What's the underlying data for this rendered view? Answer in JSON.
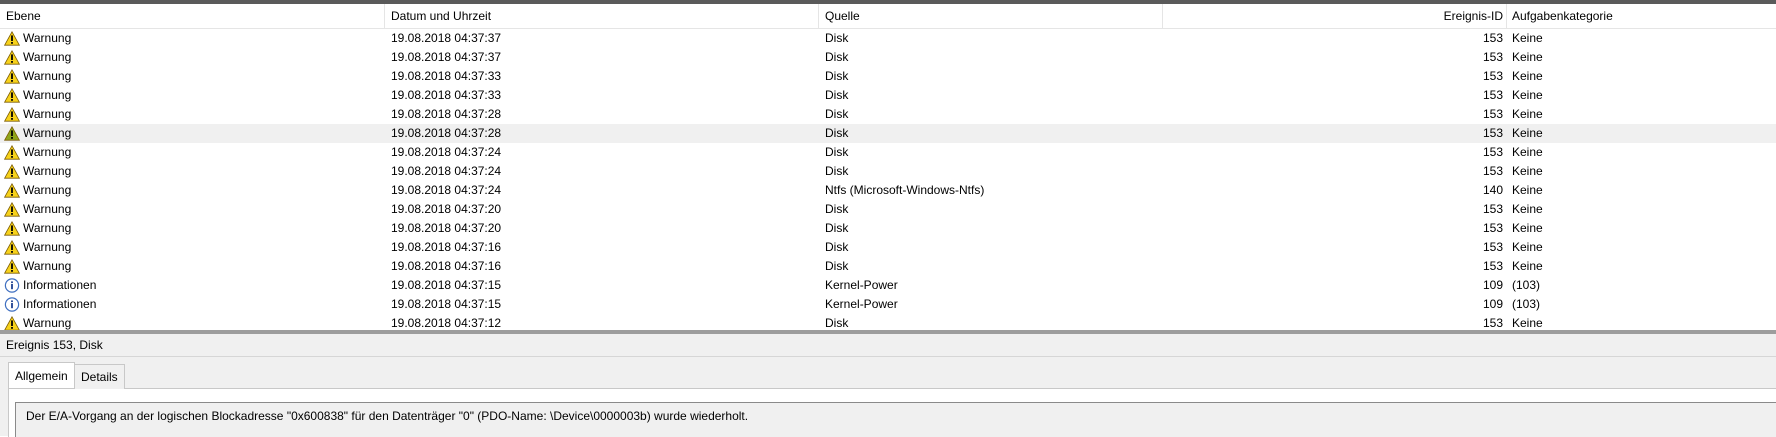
{
  "columns": {
    "level": "Ebene",
    "datetime": "Datum und Uhrzeit",
    "source": "Quelle",
    "event_id": "Ereignis-ID",
    "task_category": "Aufgabenkategorie"
  },
  "rows": [
    {
      "level": "Warnung",
      "icon": "warning-icon",
      "datetime": "19.08.2018 04:37:37",
      "source": "Disk",
      "event_id": "153",
      "category": "Keine"
    },
    {
      "level": "Warnung",
      "icon": "warning-icon",
      "datetime": "19.08.2018 04:37:37",
      "source": "Disk",
      "event_id": "153",
      "category": "Keine"
    },
    {
      "level": "Warnung",
      "icon": "warning-icon",
      "datetime": "19.08.2018 04:37:33",
      "source": "Disk",
      "event_id": "153",
      "category": "Keine"
    },
    {
      "level": "Warnung",
      "icon": "warning-icon",
      "datetime": "19.08.2018 04:37:33",
      "source": "Disk",
      "event_id": "153",
      "category": "Keine"
    },
    {
      "level": "Warnung",
      "icon": "warning-icon",
      "datetime": "19.08.2018 04:37:28",
      "source": "Disk",
      "event_id": "153",
      "category": "Keine"
    },
    {
      "level": "Warnung",
      "icon": "warning-icon",
      "datetime": "19.08.2018 04:37:28",
      "source": "Disk",
      "event_id": "153",
      "category": "Keine"
    },
    {
      "level": "Warnung",
      "icon": "warning-icon",
      "datetime": "19.08.2018 04:37:24",
      "source": "Disk",
      "event_id": "153",
      "category": "Keine"
    },
    {
      "level": "Warnung",
      "icon": "warning-icon",
      "datetime": "19.08.2018 04:37:24",
      "source": "Disk",
      "event_id": "153",
      "category": "Keine"
    },
    {
      "level": "Warnung",
      "icon": "warning-icon",
      "datetime": "19.08.2018 04:37:24",
      "source": "Ntfs (Microsoft-Windows-Ntfs)",
      "event_id": "140",
      "category": "Keine"
    },
    {
      "level": "Warnung",
      "icon": "warning-icon",
      "datetime": "19.08.2018 04:37:20",
      "source": "Disk",
      "event_id": "153",
      "category": "Keine"
    },
    {
      "level": "Warnung",
      "icon": "warning-icon",
      "datetime": "19.08.2018 04:37:20",
      "source": "Disk",
      "event_id": "153",
      "category": "Keine"
    },
    {
      "level": "Warnung",
      "icon": "warning-icon",
      "datetime": "19.08.2018 04:37:16",
      "source": "Disk",
      "event_id": "153",
      "category": "Keine"
    },
    {
      "level": "Warnung",
      "icon": "warning-icon",
      "datetime": "19.08.2018 04:37:16",
      "source": "Disk",
      "event_id": "153",
      "category": "Keine"
    },
    {
      "level": "Informationen",
      "icon": "info-icon",
      "datetime": "19.08.2018 04:37:15",
      "source": "Kernel-Power",
      "event_id": "109",
      "category": "(103)"
    },
    {
      "level": "Informationen",
      "icon": "info-icon",
      "datetime": "19.08.2018 04:37:15",
      "source": "Kernel-Power",
      "event_id": "109",
      "category": "(103)"
    },
    {
      "level": "Warnung",
      "icon": "warning-icon",
      "datetime": "19.08.2018 04:37:12",
      "source": "Disk",
      "event_id": "153",
      "category": "Keine"
    }
  ],
  "selected_row": 5,
  "detail": {
    "title": "Ereignis 153, Disk",
    "tabs": [
      "Allgemein",
      "Details"
    ],
    "active_tab": "Allgemein",
    "description": "Der E/A-Vorgang an der logischen Blockadresse \"0x600838\" für den Datenträger \"0\" (PDO-Name: \\Device\\0000003b) wurde wiederholt."
  },
  "colors": {
    "warning_fill": "#f7d21b",
    "warning_fill_selected": "#8fa51a",
    "info_ring": "#3f6fc0",
    "selection": "#f0f0f0"
  }
}
